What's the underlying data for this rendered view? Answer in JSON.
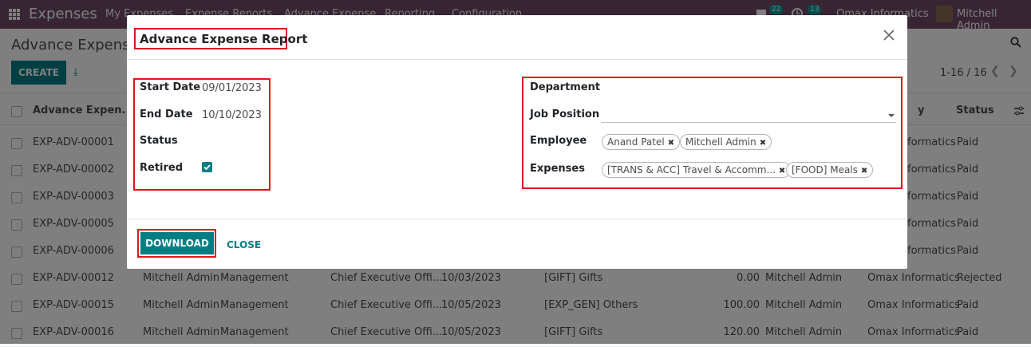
{
  "navbar": {
    "app_title": "Expenses",
    "menu": [
      "My Expenses",
      "Expense Reports",
      "Advance Expense",
      "Reporting",
      "Configuration"
    ],
    "messages_badge": "22",
    "activity_badge": "13",
    "company": "Omax Informatics",
    "user": "Mitchell Admin"
  },
  "control_panel": {
    "title": "Advance Expense",
    "create_label": "CREATE",
    "pager": "1-16 / 16"
  },
  "list": {
    "headers": {
      "name": "Advance Expen...",
      "company": "y",
      "status": "Status"
    },
    "rows": [
      {
        "ref": "EXP-ADV-00001",
        "employee": "",
        "department": "",
        "job": "",
        "date": "",
        "expense": "",
        "amount": "",
        "manager": "",
        "company": "formatics",
        "status": "Paid"
      },
      {
        "ref": "EXP-ADV-00002",
        "employee": "",
        "department": "",
        "job": "",
        "date": "",
        "expense": "",
        "amount": "",
        "manager": "",
        "company": "formatics",
        "status": "Paid"
      },
      {
        "ref": "EXP-ADV-00003",
        "employee": "",
        "department": "",
        "job": "",
        "date": "",
        "expense": "",
        "amount": "",
        "manager": "",
        "company": "formatics",
        "status": "Paid"
      },
      {
        "ref": "EXP-ADV-00005",
        "employee": "",
        "department": "",
        "job": "",
        "date": "",
        "expense": "",
        "amount": "",
        "manager": "",
        "company": "formatics",
        "status": "Paid"
      },
      {
        "ref": "EXP-ADV-00006",
        "employee": "",
        "department": "",
        "job": "",
        "date": "",
        "expense": "",
        "amount": "",
        "manager": "",
        "company": "formatics",
        "status": "Paid"
      },
      {
        "ref": "EXP-ADV-00012",
        "employee": "Mitchell Admin",
        "department": "Management",
        "job": "Chief Executive Offi...",
        "date": "10/03/2023",
        "expense": "[GIFT] Gifts",
        "amount": "0.00",
        "manager": "Mitchell Admin",
        "company": "Omax Informatics",
        "status": "Rejected"
      },
      {
        "ref": "EXP-ADV-00015",
        "employee": "Mitchell Admin",
        "department": "Management",
        "job": "Chief Executive Offi...",
        "date": "10/05/2023",
        "expense": "[EXP_GEN] Others",
        "amount": "100.00",
        "manager": "Mitchell Admin",
        "company": "Omax Informatics",
        "status": "Paid"
      },
      {
        "ref": "EXP-ADV-00016",
        "employee": "Mitchell Admin",
        "department": "Management",
        "job": "Chief Executive Offi...",
        "date": "10/05/2023",
        "expense": "[GIFT] Gifts",
        "amount": "120.00",
        "manager": "Mitchell Admin",
        "company": "Omax Informatics",
        "status": "Paid"
      }
    ]
  },
  "modal": {
    "title": "Advance Expense Report",
    "start_date_label": "Start Date",
    "start_date_value": "09/01/2023",
    "end_date_label": "End Date",
    "end_date_value": "10/10/2023",
    "status_label": "Status",
    "retired_label": "Retired",
    "retired_checked": true,
    "department_label": "Department",
    "job_position_label": "Job Position",
    "employee_label": "Employee",
    "employee_tags": [
      "Anand Patel",
      "Mitchell Admin"
    ],
    "expenses_label": "Expenses",
    "expense_tags": [
      "[TRANS & ACC] Travel & Accomm...",
      "[FOOD] Meals"
    ],
    "download_label": "DOWNLOAD",
    "close_label": "CLOSE"
  },
  "colors": {
    "navbar": "#714B67",
    "primary": "#017e84",
    "highlight": "#e0161c"
  }
}
